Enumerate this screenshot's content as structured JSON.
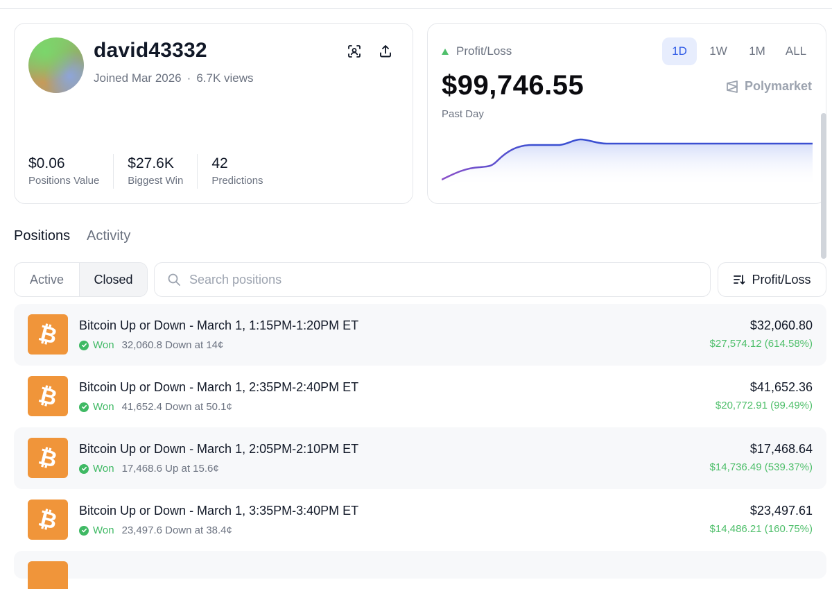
{
  "profile": {
    "username": "david43332",
    "joined": "Joined Mar 2026",
    "separator": "·",
    "views": "6.7K views",
    "stats": [
      {
        "value": "$0.06",
        "label": "Positions Value"
      },
      {
        "value": "$27.6K",
        "label": "Biggest Win"
      },
      {
        "value": "42",
        "label": "Predictions"
      }
    ],
    "icons": {
      "scan": "scan-icon",
      "share": "share-icon"
    }
  },
  "pnl": {
    "label": "Profit/Loss",
    "amount": "$99,746.55",
    "period_label": "Past Day",
    "brand": "Polymarket",
    "ranges": [
      "1D",
      "1W",
      "1M",
      "ALL"
    ],
    "active_range": "1D",
    "colors": {
      "up": "#4fbf6b",
      "line": "#3b4fd1",
      "accent": "#2f5be6"
    }
  },
  "tabs": {
    "positions": "Positions",
    "activity": "Activity",
    "active_tab": "Positions"
  },
  "filters": {
    "active_label": "Active",
    "closed_label": "Closed",
    "selected": "Closed",
    "search_placeholder": "Search positions",
    "sort_label": "Profit/Loss"
  },
  "positions": [
    {
      "title": "Bitcoin Up or Down - March 1, 1:15PM-1:20PM ET",
      "status": "Won",
      "detail": "32,060.8 Down at 14¢",
      "value": "$32,060.80",
      "pnl": "$27,574.12 (614.58%)"
    },
    {
      "title": "Bitcoin Up or Down - March 1, 2:35PM-2:40PM ET",
      "status": "Won",
      "detail": "41,652.4 Down at 50.1¢",
      "value": "$41,652.36",
      "pnl": "$20,772.91 (99.49%)"
    },
    {
      "title": "Bitcoin Up or Down - March 1, 2:05PM-2:10PM ET",
      "status": "Won",
      "detail": "17,468.6 Up at 15.6¢",
      "value": "$17,468.64",
      "pnl": "$14,736.49 (539.37%)"
    },
    {
      "title": "Bitcoin Up or Down - March 1, 3:35PM-3:40PM ET",
      "status": "Won",
      "detail": "23,497.6 Down at 38.4¢",
      "value": "$23,497.61",
      "pnl": "$14,486.21 (160.75%)"
    }
  ],
  "coin_glyph": "₿",
  "coin_color": "#f0953a"
}
